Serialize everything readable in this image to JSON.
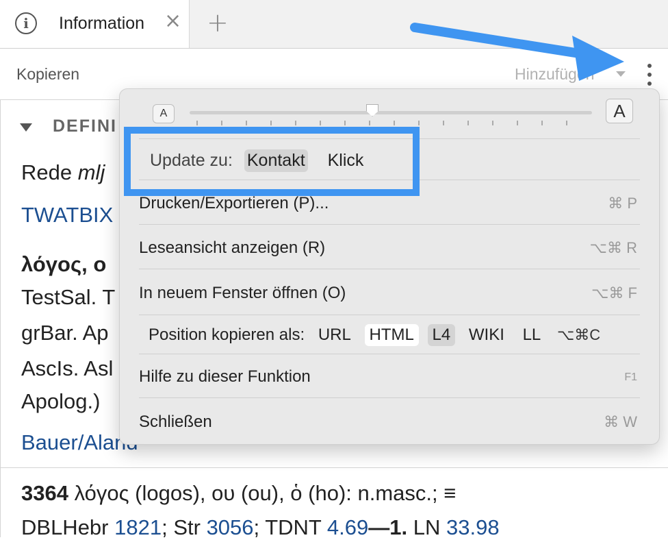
{
  "tab": {
    "icon": "info-icon",
    "title": "Information",
    "close_icon": "close-icon",
    "add_icon": "plus-icon"
  },
  "toolbar": {
    "copy_label": "Kopieren",
    "add_label": "Hinzufügen",
    "more_icon": "kebab-menu-icon"
  },
  "content": {
    "section_title": "DEFINI",
    "lines": [
      "Rede mlj",
      "TWATBIX",
      "λόγος, ο",
      "TestSal. T",
      "grBar. Ap",
      "AscIs. Asl",
      "Apolog.)",
      "Bauer/Aland"
    ],
    "entry_num": "3364",
    "entry_text": "λόγος (logos), ου (ou), ὁ (ho): n.masc.;",
    "ref_line_prefix": "DBLHebr",
    "ref_1821": "1821",
    "ref_str": "; Str",
    "ref_3056": "3056",
    "ref_tdnt": "; TDNT",
    "ref_469": "4.69",
    "ref_bold": "—1.",
    "ref_ln": " LN",
    "ref_3398": "33.98"
  },
  "menu": {
    "font_small": "A",
    "font_large": "A",
    "update_label": "Update zu:",
    "update_options": [
      "Kontakt",
      "Klick"
    ],
    "items": [
      {
        "label": "Drucken/Exportieren (P)...",
        "shortcut": "⌘ P"
      },
      {
        "label": "Leseansicht anzeigen (R)",
        "shortcut": "⌥⌘ R"
      },
      {
        "label": "In neuem Fenster öffnen (O)",
        "shortcut": "⌥⌘ F"
      },
      {
        "label": "Hilfe zu dieser Funktion",
        "shortcut": "F1"
      },
      {
        "label": "Schließen",
        "shortcut": "⌘ W"
      }
    ],
    "position_label": "Position kopieren als:",
    "position_options": [
      "URL",
      "HTML",
      "L4",
      "WIKI",
      "LL"
    ],
    "position_shortcut": "⌥⌘C"
  },
  "colors": {
    "annotation": "#3f95f1",
    "link": "#1c4f91"
  }
}
